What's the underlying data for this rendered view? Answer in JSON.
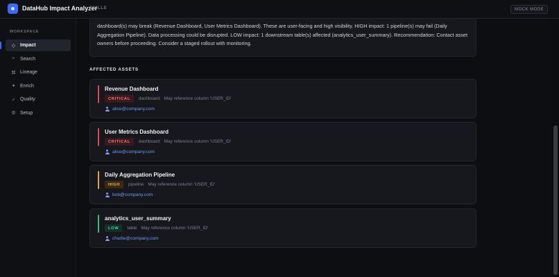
{
  "app": {
    "title": "DataHub Impact Analyzer",
    "badge": "SKILLS",
    "mock_mode": "MOCK MODE",
    "accent_color": "#3b6bf5"
  },
  "sidebar": {
    "section_label": "WORKSPACE",
    "items": [
      {
        "label": "Impact",
        "icon": "diamond-icon",
        "glyph": "◇",
        "active": true
      },
      {
        "label": "Search",
        "icon": "search-icon",
        "glyph": "⌕",
        "active": false
      },
      {
        "label": "Lineage",
        "icon": "lineage-icon",
        "glyph": "⌘",
        "active": false
      },
      {
        "label": "Enrich",
        "icon": "sparkle-icon",
        "glyph": "✦",
        "active": false
      },
      {
        "label": "Quality",
        "icon": "check-icon",
        "glyph": "✓",
        "active": false
      },
      {
        "label": "Setup",
        "icon": "gear-icon",
        "glyph": "⚙",
        "active": false
      }
    ]
  },
  "summary": {
    "text": "dashboard(s) may break (Revenue Dashboard, User Metrics Dashboard). These are user-facing and high visibility. HIGH impact: 1 pipeline(s) may fail (Daily Aggregation Pipeline). Data processing could be disrupted. LOW impact: 1 downstream table(s) affected (analytics_user_summary). Recommendation: Contact asset owners before proceeding. Consider a staged rollout with monitoring."
  },
  "assets": {
    "section_label": "AFFECTED ASSETS",
    "items": [
      {
        "name": "Revenue Dashboard",
        "severity": "CRITICAL",
        "type": "dashboard",
        "note": "May reference column 'USER_ID'",
        "owner": "alice@company.com",
        "accent": "#e0474c",
        "badge_bg": "#3a1a1c",
        "badge_fg": "#f07a7e"
      },
      {
        "name": "User Metrics Dashboard",
        "severity": "CRITICAL",
        "type": "dashboard",
        "note": "May reference column 'USER_ID'",
        "owner": "alice@company.com",
        "accent": "#e0474c",
        "badge_bg": "#3a1a1c",
        "badge_fg": "#f07a7e"
      },
      {
        "name": "Daily Aggregation Pipeline",
        "severity": "HIGH",
        "type": "pipeline",
        "note": "May reference column 'USER_ID'",
        "owner": "bob@company.com",
        "accent": "#e8a23a",
        "badge_bg": "#3a2a14",
        "badge_fg": "#f0b054"
      },
      {
        "name": "analytics_user_summary",
        "severity": "LOW",
        "type": "table",
        "note": "May reference column 'USER_ID'",
        "owner": "charlie@company.com",
        "accent": "#2fbf7e",
        "badge_bg": "#15302a",
        "badge_fg": "#4fd494"
      }
    ]
  }
}
